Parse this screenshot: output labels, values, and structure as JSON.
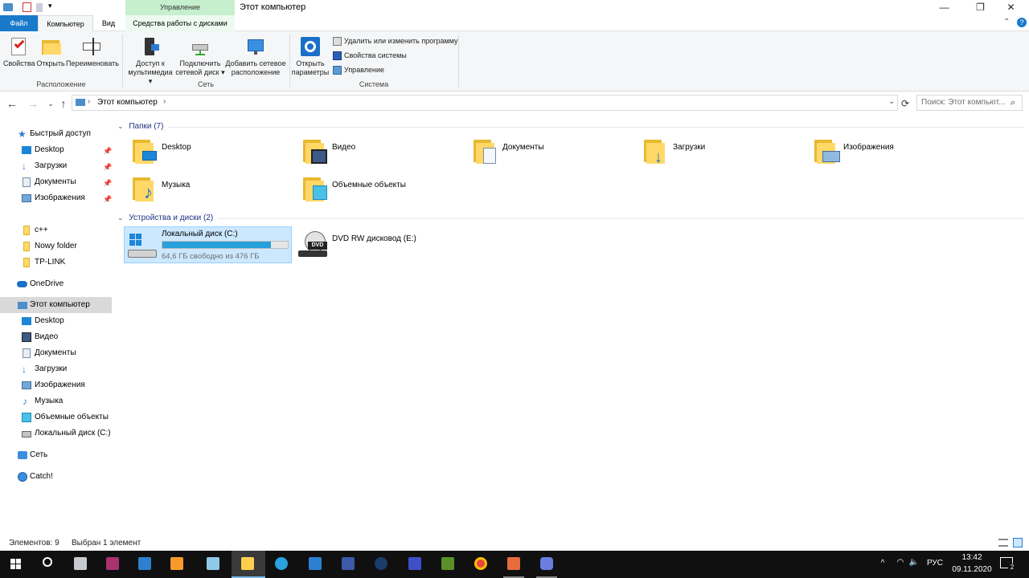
{
  "titlebar": {
    "context_tab": "Управление",
    "window_title": "Этот компьютер"
  },
  "tabs": [
    "Файл",
    "Компьютер",
    "Вид",
    "Средства работы с дисками"
  ],
  "ribbon": {
    "groups": [
      {
        "label": "Расположение",
        "buttons": [
          "Свойства",
          "Открыть",
          "Переименовать"
        ]
      },
      {
        "label": "Сеть",
        "buttons": [
          "Доступ к мультимедиа",
          "Подключить сетевой диск",
          "Добавить сетевое расположение"
        ]
      },
      {
        "label": "Система",
        "open_settings": "Открыть параметры",
        "small": [
          "Удалить или изменить программу",
          "Свойства системы",
          "Управление"
        ]
      }
    ]
  },
  "address": {
    "path": "Этот компьютер",
    "search_placeholder": "Поиск: Этот компьют..."
  },
  "navpane": {
    "quick_access": "Быстрый доступ",
    "quick_items": [
      "Desktop",
      "Загрузки",
      "Документы",
      "Изображения"
    ],
    "folders": [
      "c++",
      "Nowy folder",
      "TP-LINK"
    ],
    "onedrive": "OneDrive",
    "this_pc": "Этот компьютер",
    "pc_items": [
      "Desktop",
      "Видео",
      "Документы",
      "Загрузки",
      "Изображения",
      "Музыка",
      "Объемные объекты",
      "Локальный диск (C:)"
    ],
    "network": "Сеть",
    "catch": "Catch!"
  },
  "content": {
    "folders_header": "Папки (7)",
    "folders": [
      "Desktop",
      "Видео",
      "Документы",
      "Загрузки",
      "Изображения",
      "Музыка",
      "Объемные объекты"
    ],
    "devices_header": "Устройства и диски (2)",
    "drives": [
      {
        "name": "Локальный диск (C:)",
        "free": "64,6 ГБ свободно из 476 ГБ",
        "used_fraction": 0.864
      },
      {
        "name": "DVD RW дисковод (E:)"
      }
    ]
  },
  "status": {
    "items": "Элементов: 9",
    "selected": "Выбран 1 элемент"
  },
  "taskbar": {
    "lang": "РУС",
    "time": "13:42",
    "date": "09.11.2020",
    "notif_count": "2"
  }
}
